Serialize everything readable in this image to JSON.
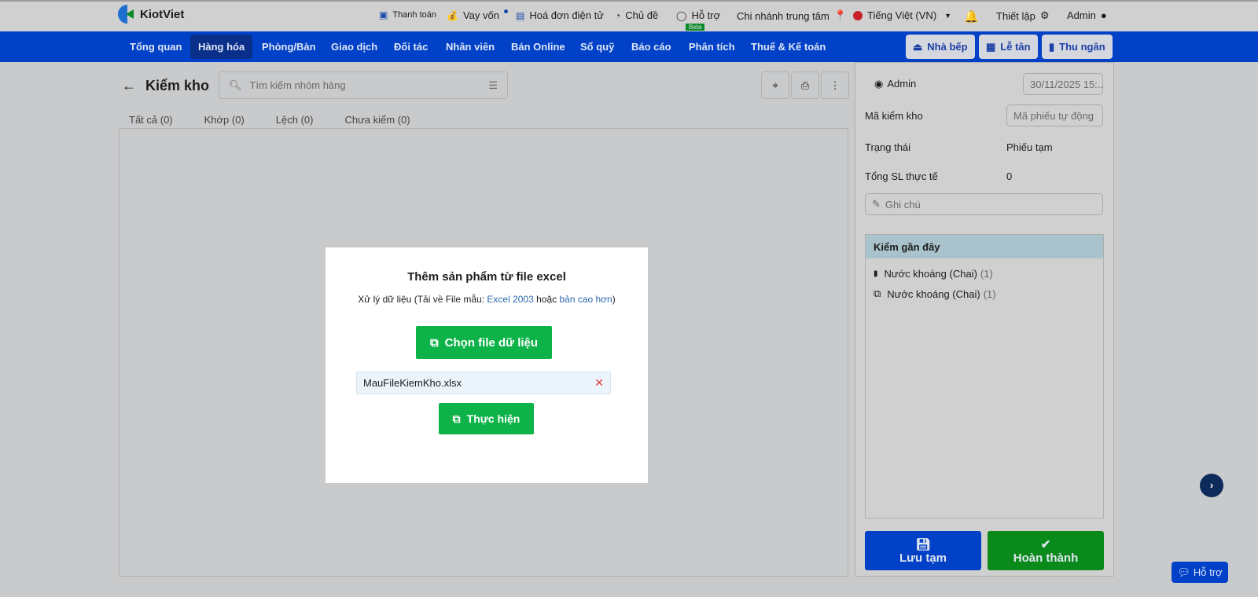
{
  "topbar": {
    "brand": "KiotViet",
    "links": [
      "Thanh toán",
      "Vay vốn",
      "Hoá đơn điện tử",
      "Chủ đề",
      "Hỗ trợ"
    ],
    "beta": "Beta",
    "branch": "Chi nhánh trung tâm",
    "language": "Tiếng Việt (VN)",
    "settings": "Thiết lập",
    "user": "Admin"
  },
  "nav": {
    "items": [
      "Tổng quan",
      "Hàng hóa",
      "Phòng/Bàn",
      "Giao dịch",
      "Đối tác",
      "Nhân viên",
      "Bán Online",
      "Sổ quỹ",
      "Báo cáo",
      "Phân tích",
      "Thuế & Kế toán"
    ],
    "active": 1,
    "buttons": [
      "Nhà bếp",
      "Lễ tân",
      "Thu ngân"
    ]
  },
  "page": {
    "title": "Kiểm kho",
    "search_placeholder": "Tìm kiếm nhóm hàng",
    "tabs": [
      "Tất cả (0)",
      "Khớp (0)",
      "Lệch (0)",
      "Chưa kiểm (0)"
    ]
  },
  "modal": {
    "title": "Thêm sản phẩm từ file excel",
    "desc_prefix": "Xử lý dữ liệu (Tải về File mẫu: ",
    "link1": "Excel 2003",
    "mid": " hoặc ",
    "link2": "bản cao hơn",
    "desc_suffix": ")",
    "choose": "Chọn file dữ liệu",
    "file": "MauFileKiemKho.xlsx",
    "execute": "Thực hiện"
  },
  "side": {
    "user": "Admin",
    "date": "30/11/2025 15:...",
    "code_label": "Mã kiểm kho",
    "code_placeholder": "Mã phiếu tự động",
    "status_label": "Trạng thái",
    "status": "Phiếu tạm",
    "total_label": "Tổng SL thực tế",
    "total": "0",
    "note_placeholder": "Ghi chú",
    "recent_title": "Kiểm gần đây",
    "recent": [
      {
        "name": "Nước khoáng (Chai)",
        "count": "(1)"
      },
      {
        "name": "Nước khoáng (Chai)",
        "count": "(1)"
      }
    ],
    "save": "Lưu tạm",
    "done": "Hoàn thành"
  },
  "help": "Hỗ trợ"
}
